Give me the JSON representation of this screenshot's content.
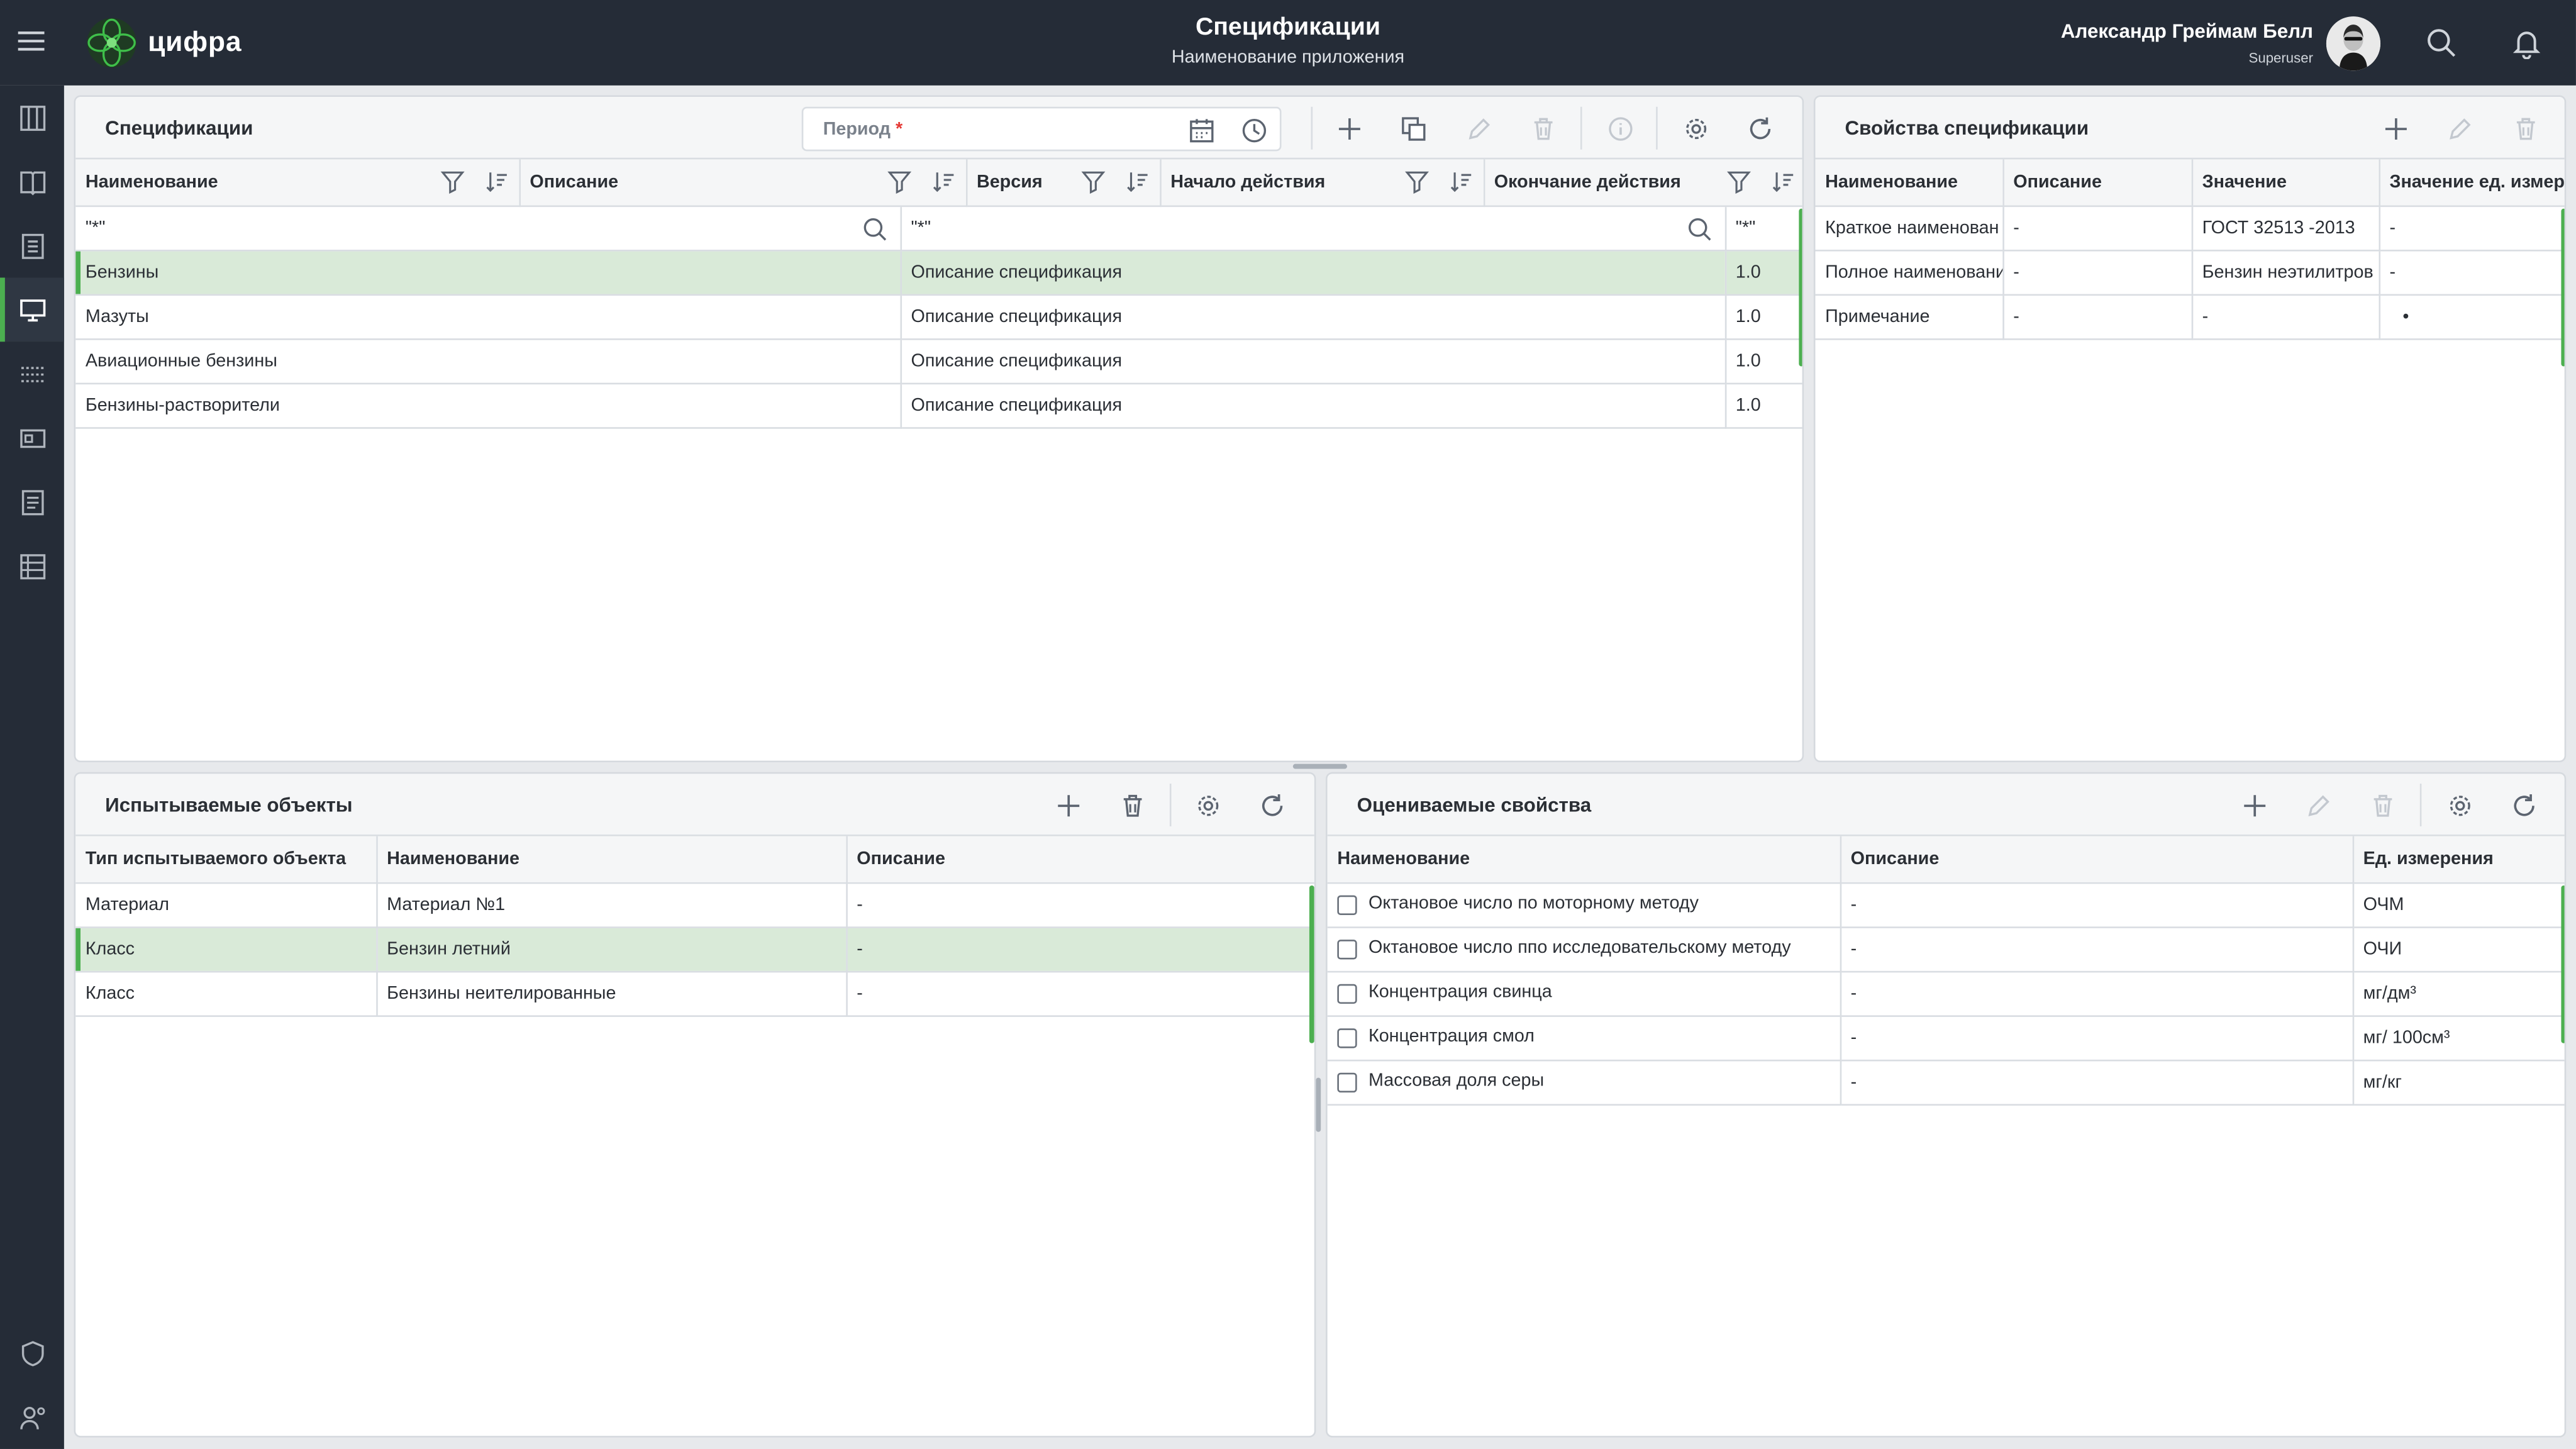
{
  "topbar": {
    "logo_text": "цифра",
    "title": "Спецификации",
    "subtitle": "Наименование приложения",
    "user_name": "Александр Греймам Белл",
    "user_role": "Superuser"
  },
  "sidebar": {
    "items": [
      "columns-icon",
      "book-icon",
      "list-icon",
      "monitor-icon",
      "dots-grid-icon",
      "card-icon",
      "document-list-icon",
      "table-icon",
      "shield-icon",
      "users-settings-icon"
    ],
    "active_index": 3
  },
  "specs": {
    "title": "Спецификации",
    "period_label": "Период",
    "period_required": "*",
    "columns": [
      "Наименование",
      "Описание",
      "Версия",
      "Начало действия",
      "Окончание действия"
    ],
    "filters": [
      "\"*\"",
      "\"*\"",
      "\"*\""
    ],
    "rows": [
      {
        "name": "Бензины",
        "desc": "Описание спецификация",
        "ver": "1.0"
      },
      {
        "name": "Мазуты",
        "desc": "Описание спецификация",
        "ver": "1.0"
      },
      {
        "name": "Авиационные бензины",
        "desc": "Описание спецификация",
        "ver": "1.0"
      },
      {
        "name": "Бензины-растворители",
        "desc": "Описание спецификация",
        "ver": "1.0"
      }
    ],
    "selected_row": 0
  },
  "props": {
    "title": "Свойства спецификации",
    "columns": [
      "Наименование",
      "Описание",
      "Значение",
      "Значение ед. измере"
    ],
    "rows": [
      {
        "name": "Краткое наименован",
        "desc": "-",
        "value": "ГОСТ 32513  -2013",
        "unit": "-"
      },
      {
        "name": "Полное наименовани",
        "desc": "-",
        "value": "Бензин неэтилитров",
        "unit": "-"
      },
      {
        "name": "Примечание",
        "desc": "-",
        "value": "-",
        "unit": "•"
      }
    ]
  },
  "objects": {
    "title": "Испытываемые объекты",
    "columns": [
      "Тип испытываемого объекта",
      "Наименование",
      "Описание"
    ],
    "rows": [
      {
        "type": "Материал",
        "name": "Материал  №1",
        "desc": "-"
      },
      {
        "type": "Класс",
        "name": "Бензин летний",
        "desc": "-"
      },
      {
        "type": "Класс",
        "name": "Бензины неителированные",
        "desc": "-"
      }
    ],
    "selected_row": 1
  },
  "evaluated": {
    "title": "Оцениваемые свойства",
    "columns": [
      "Наименование",
      "Описание",
      "Ед. измерения"
    ],
    "rows": [
      {
        "name": "Октановое число  по моторному методу",
        "desc": "-",
        "unit": "ОЧМ"
      },
      {
        "name": "Октановое число  ппо исследовательскому методу",
        "desc": "-",
        "unit": "ОЧИ"
      },
      {
        "name": "Концентрация свинца",
        "desc": "-",
        "unit": "мг/дм³"
      },
      {
        "name": "Концентрация смол",
        "desc": "-",
        "unit": "мг/ 100см³"
      },
      {
        "name": "Массовая доля  серы",
        "desc": "-",
        "unit": "мг/кг"
      }
    ]
  },
  "colors": {
    "accent": "#4caf50",
    "topbar": "#252c37",
    "selected_row": "#d9ead8"
  }
}
